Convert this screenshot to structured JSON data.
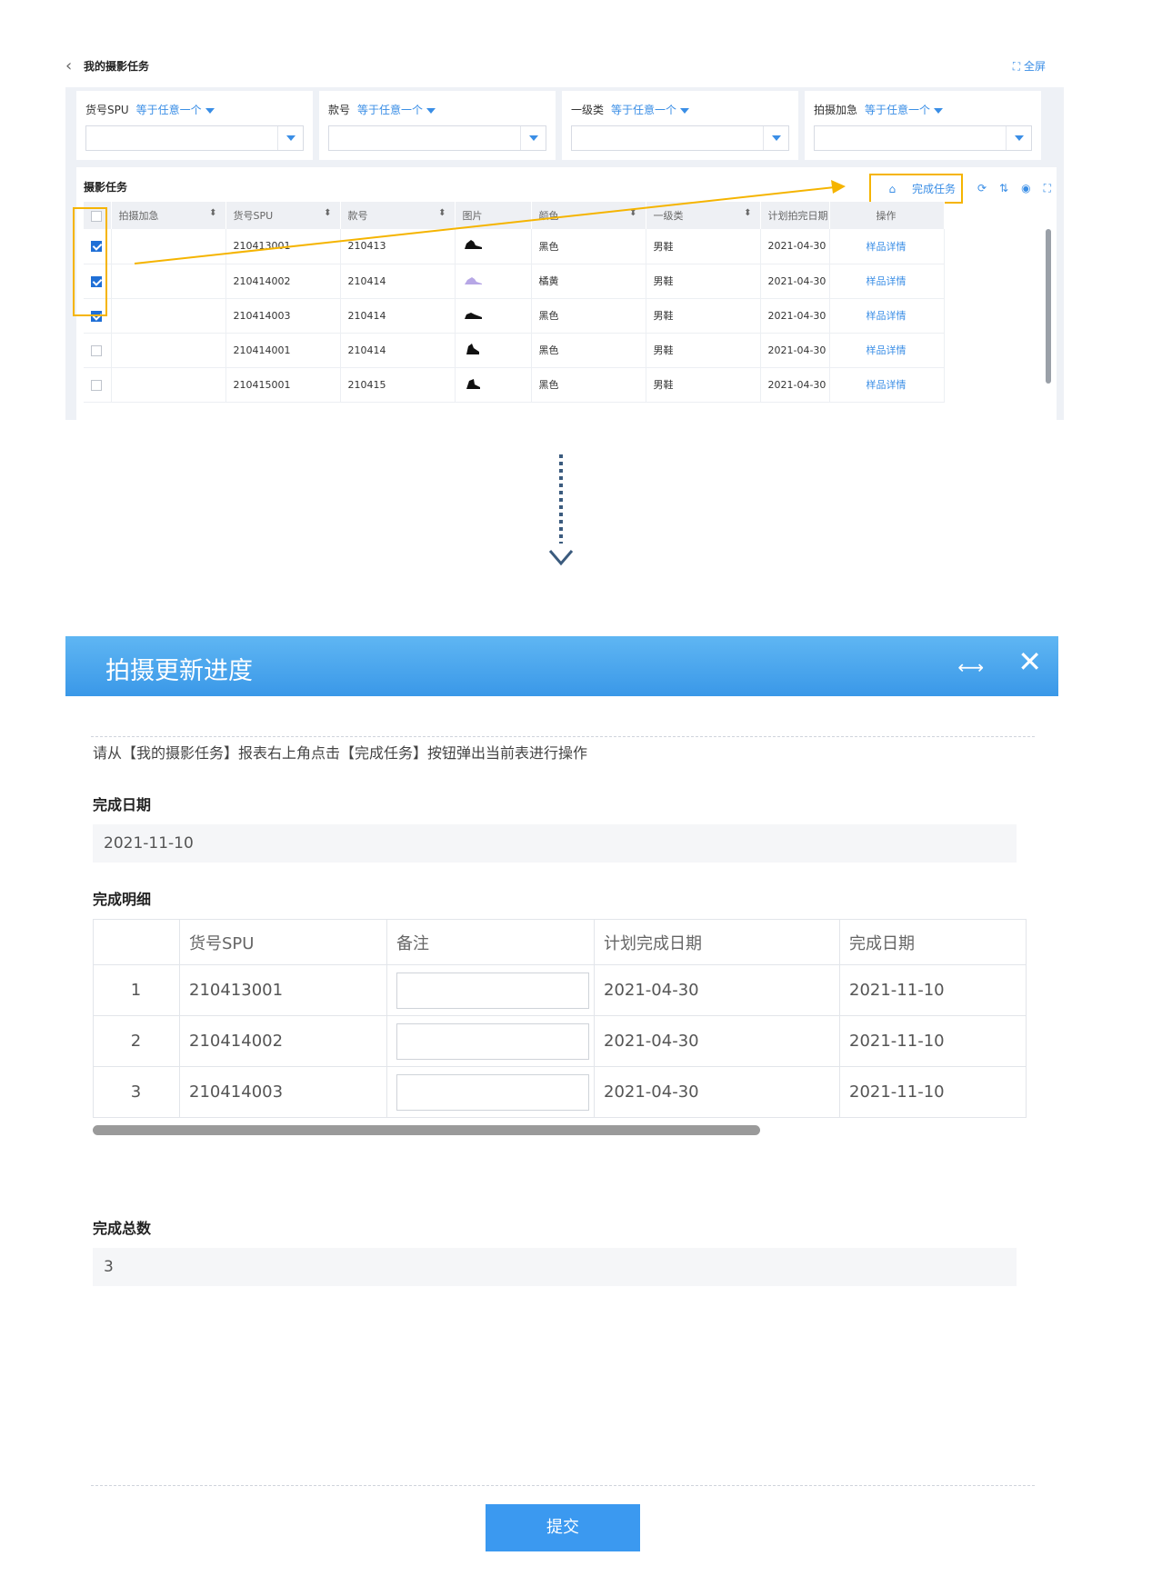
{
  "report": {
    "title": "我的摄影任务",
    "fullscreen_label": "全屏",
    "filters": [
      {
        "label": "货号SPU",
        "op": "等于任意一个"
      },
      {
        "label": "款号",
        "op": "等于任意一个"
      },
      {
        "label": "一级类",
        "op": "等于任意一个"
      },
      {
        "label": "拍摄加急",
        "op": "等于任意一个"
      }
    ],
    "section_title": "摄影任务",
    "complete_label": "完成任务",
    "columns": [
      "拍摄加急",
      "货号SPU",
      "款号",
      "图片",
      "颜色",
      "一级类",
      "计划拍完日期",
      "操作"
    ],
    "rows": [
      {
        "checked": true,
        "urgent": "",
        "spu": "210413001",
        "style": "210413",
        "color": "黑色",
        "category": "男鞋",
        "date": "2021-04-30",
        "action": "样品详情"
      },
      {
        "checked": true,
        "urgent": "",
        "spu": "210414002",
        "style": "210414",
        "color": "橘黄",
        "category": "男鞋",
        "date": "2021-04-30",
        "action": "样品详情"
      },
      {
        "checked": true,
        "urgent": "",
        "spu": "210414003",
        "style": "210414",
        "color": "黑色",
        "category": "男鞋",
        "date": "2021-04-30",
        "action": "样品详情"
      },
      {
        "checked": false,
        "urgent": "",
        "spu": "210414001",
        "style": "210414",
        "color": "黑色",
        "category": "男鞋",
        "date": "2021-04-30",
        "action": "样品详情"
      },
      {
        "checked": false,
        "urgent": "",
        "spu": "210415001",
        "style": "210415",
        "color": "黑色",
        "category": "男鞋",
        "date": "2021-04-30",
        "action": "样品详情"
      }
    ]
  },
  "modal": {
    "title": "拍摄更新进度",
    "hint": "请从【我的摄影任务】报表右上角点击【完成任务】按钮弹出当前表进行操作",
    "done_date_label": "完成日期",
    "done_date_value": "2021-11-10",
    "detail_label": "完成明细",
    "detail_columns": [
      "",
      "货号SPU",
      "备注",
      "计划完成日期",
      "完成日期"
    ],
    "detail_rows": [
      {
        "no": "1",
        "spu": "210413001",
        "note": "",
        "plan": "2021-04-30",
        "done": "2021-11-10"
      },
      {
        "no": "2",
        "spu": "210414002",
        "note": "",
        "plan": "2021-04-30",
        "done": "2021-11-10"
      },
      {
        "no": "3",
        "spu": "210414003",
        "note": "",
        "plan": "2021-04-30",
        "done": "2021-11-10"
      }
    ],
    "total_label": "完成总数",
    "total_value": "3",
    "submit_label": "提交"
  },
  "colors": {
    "accent": "#3a8ee6",
    "highlight": "#f5b400",
    "header": "#3a98e8"
  }
}
